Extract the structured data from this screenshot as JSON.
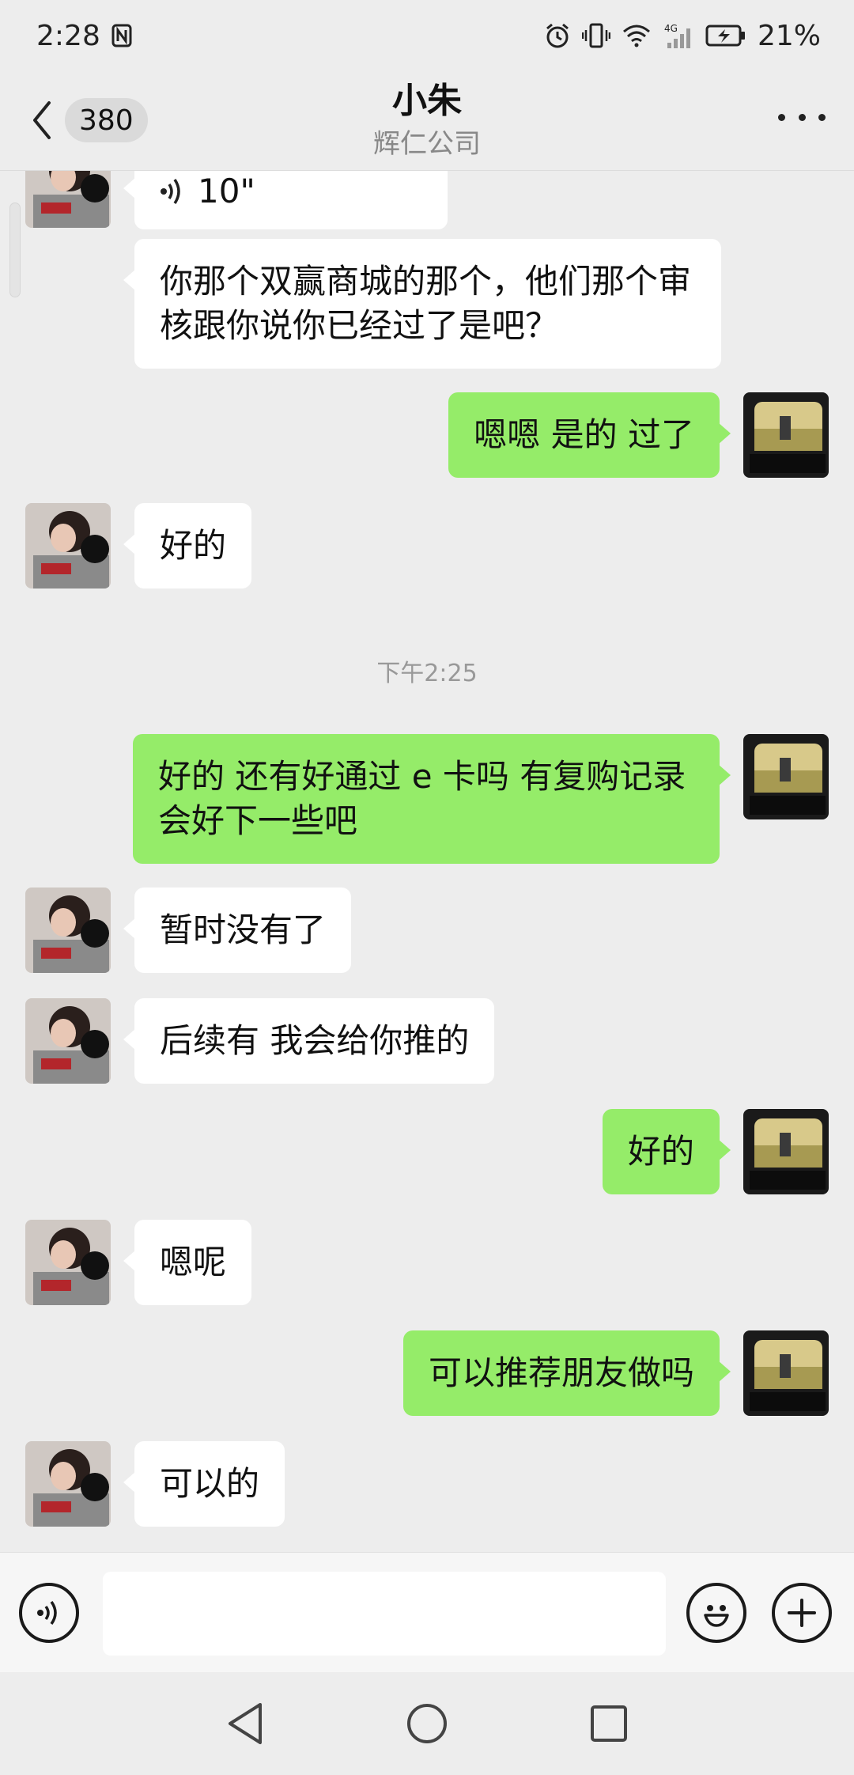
{
  "status_bar": {
    "time": "2:28",
    "battery": "21%",
    "network": "4G",
    "icons": [
      "nfc-icon",
      "alarm-icon",
      "vibrate-icon",
      "wifi-icon",
      "signal-icon",
      "battery-icon"
    ]
  },
  "header": {
    "unread_count": "380",
    "title": "小朱",
    "subtitle": "辉仁公司"
  },
  "messages": [
    {
      "dir": "in",
      "type": "voice",
      "duration": "10\""
    },
    {
      "dir": "in",
      "type": "text",
      "text": "你那个双赢商城的那个，他们那个审核跟你说你已经过了是吧？"
    },
    {
      "dir": "out",
      "type": "text",
      "text": "嗯嗯 是的 过了"
    },
    {
      "dir": "in",
      "type": "text",
      "text": "好的"
    },
    {
      "type": "time",
      "text": "下午2:25"
    },
    {
      "dir": "out",
      "type": "text",
      "text": "好的 还有好通过 e 卡吗 有复购记录会好下一些吧"
    },
    {
      "dir": "in",
      "type": "text",
      "text": "暂时没有了"
    },
    {
      "dir": "in",
      "type": "text",
      "text": "后续有 我会给你推的"
    },
    {
      "dir": "out",
      "type": "text",
      "text": "好的"
    },
    {
      "dir": "in",
      "type": "text",
      "text": "嗯呢"
    },
    {
      "dir": "out",
      "type": "text",
      "text": "可以推荐朋友做吗"
    },
    {
      "dir": "in",
      "type": "text",
      "text": "可以的"
    }
  ],
  "input_bar": {
    "value": "",
    "icons": [
      "voice-input-icon",
      "emoji-icon",
      "plus-icon"
    ]
  },
  "nav": [
    "back-nav-icon",
    "home-nav-icon",
    "recents-nav-icon"
  ],
  "colors": {
    "background": "#ededed",
    "outgoing_bubble": "#95ec69",
    "incoming_bubble": "#ffffff"
  }
}
